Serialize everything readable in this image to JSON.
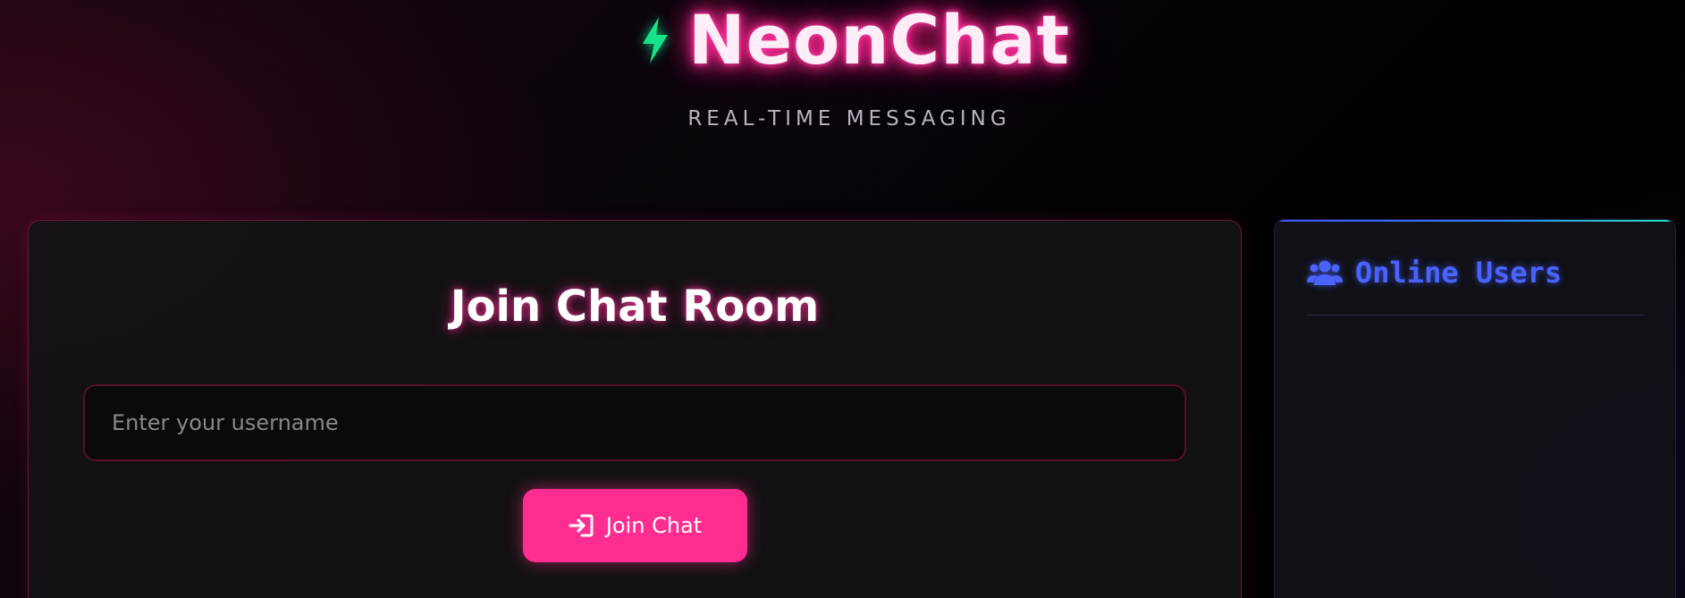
{
  "header": {
    "brand_icon": "lightning-bolt-icon",
    "brand_name": "NeonChat",
    "tagline": "REAL-TIME MESSAGING"
  },
  "join": {
    "title": "Join Chat Room",
    "username_placeholder": "Enter your username",
    "username_value": "",
    "join_button_label": "Join Chat",
    "join_button_icon": "sign-in-icon"
  },
  "users_panel": {
    "title": "Online Users",
    "icon": "users-icon",
    "users": []
  },
  "colors": {
    "brand_glow": "#ff2d96",
    "bolt": "#19e38a",
    "button": "#ff2d8f",
    "users_accent": "#4a63ff"
  }
}
